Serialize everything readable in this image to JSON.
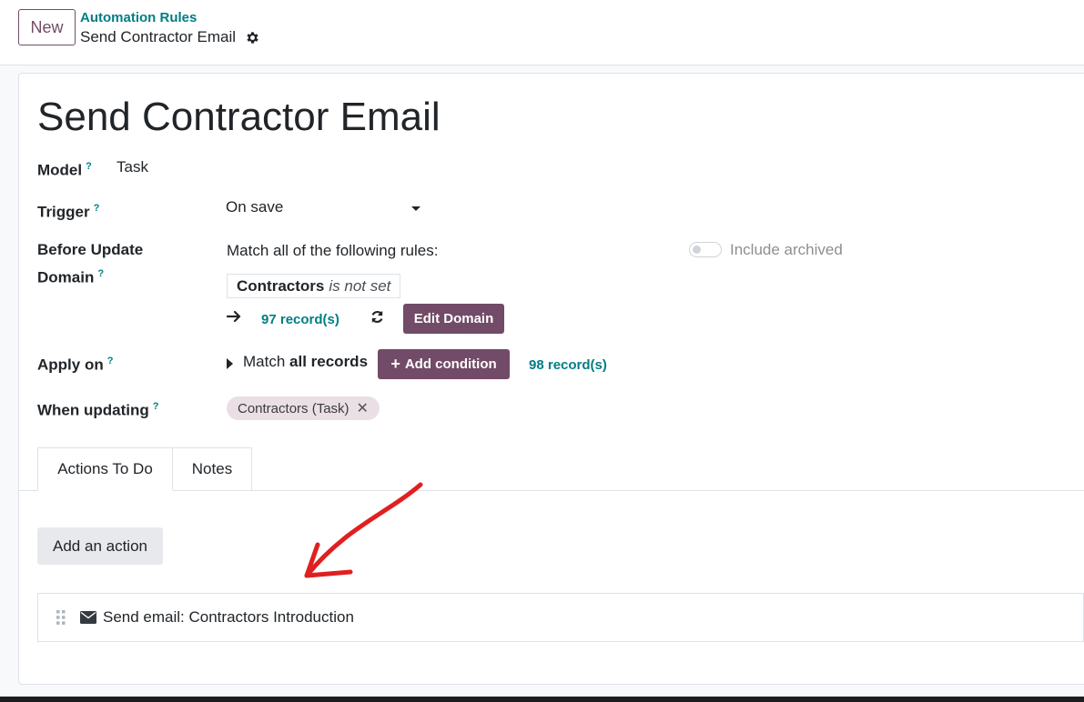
{
  "control_panel": {
    "new_button": "New",
    "breadcrumb_parent": "Automation Rules",
    "breadcrumb_current": "Send Contractor Email"
  },
  "form": {
    "title": "Send Contractor Email",
    "model_label": "Model",
    "model_value": "Task",
    "trigger_label": "Trigger",
    "trigger_value": "On save",
    "before_update_label_line1": "Before Update",
    "before_update_label_line2": "Domain",
    "match_all_text": "Match all of the following rules:",
    "include_archived": "Include archived",
    "domain_field": "Contractors",
    "domain_operator": "is not set",
    "domain_record_count": "97 record(s)",
    "edit_domain_button": "Edit Domain",
    "apply_on_label": "Apply on",
    "match_prefix": "Match",
    "match_bold": "all records",
    "add_condition_button": "Add condition",
    "apply_record_count": "98 record(s)",
    "when_updating_label": "When updating",
    "when_updating_tag": "Contractors (Task)",
    "help_marker": "?"
  },
  "tabs": [
    {
      "label": "Actions To Do",
      "active": true
    },
    {
      "label": "Notes",
      "active": false
    }
  ],
  "actions": {
    "add_button": "Add an action",
    "items": [
      {
        "label": "Send email: Contractors Introduction"
      }
    ]
  },
  "colors": {
    "brand": "#714b67",
    "link": "#017e84",
    "annotation_arrow": "#e02020"
  }
}
